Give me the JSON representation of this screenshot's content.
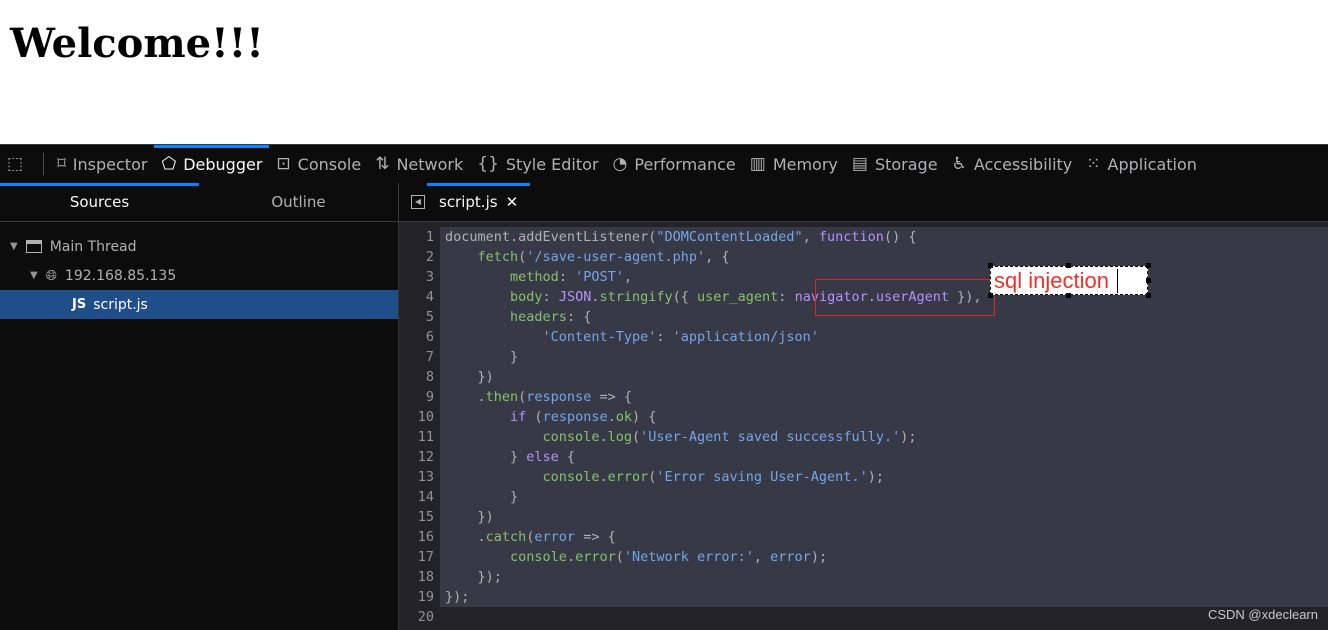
{
  "page": {
    "heading": "Welcome!!!"
  },
  "toolbar": {
    "tools": [
      {
        "label": "Inspector",
        "icon": "inspector-icon",
        "glyph": "⌑"
      },
      {
        "label": "Debugger",
        "icon": "debugger-icon",
        "glyph": "⬠"
      },
      {
        "label": "Console",
        "icon": "console-icon",
        "glyph": "⊡"
      },
      {
        "label": "Network",
        "icon": "network-icon",
        "glyph": "⇅"
      },
      {
        "label": "Style Editor",
        "icon": "style-editor-icon",
        "glyph": "{}"
      },
      {
        "label": "Performance",
        "icon": "performance-icon",
        "glyph": "◔"
      },
      {
        "label": "Memory",
        "icon": "memory-icon",
        "glyph": "▥"
      },
      {
        "label": "Storage",
        "icon": "storage-icon",
        "glyph": "▤"
      },
      {
        "label": "Accessibility",
        "icon": "accessibility-icon",
        "glyph": "♿"
      },
      {
        "label": "Application",
        "icon": "application-icon",
        "glyph": "⁙"
      }
    ],
    "active": "Debugger"
  },
  "sources": {
    "tabs": [
      "Sources",
      "Outline"
    ],
    "thread": "Main Thread",
    "host": "192.168.85.135",
    "file_badge": "JS",
    "file": "script.js"
  },
  "editor": {
    "tab": "script.js",
    "close": "✕",
    "lines": [
      [
        [
          "v",
          "document.addEventListener("
        ],
        [
          "s",
          "\"DOMContentLoaded\""
        ],
        [
          "v",
          ", "
        ],
        [
          "k",
          "function"
        ],
        [
          "v",
          "() {"
        ]
      ],
      [
        [
          "v",
          "    "
        ],
        [
          "p",
          "fetch"
        ],
        [
          "v",
          "("
        ],
        [
          "s",
          "'/save-user-agent.php'"
        ],
        [
          "v",
          ", {"
        ]
      ],
      [
        [
          "v",
          "        "
        ],
        [
          "p",
          "method"
        ],
        [
          "v",
          ": "
        ],
        [
          "s",
          "'POST'"
        ],
        [
          "v",
          ","
        ]
      ],
      [
        [
          "v",
          "        "
        ],
        [
          "p",
          "body"
        ],
        [
          "v",
          ": "
        ],
        [
          "f",
          "JSON"
        ],
        [
          "v",
          "."
        ],
        [
          "p",
          "stringify"
        ],
        [
          "v",
          "({ "
        ],
        [
          "p",
          "user_agent"
        ],
        [
          "v",
          ": "
        ],
        [
          "f",
          "navigator"
        ],
        [
          "v",
          "."
        ],
        [
          "f",
          "userAgent"
        ],
        [
          "v",
          " }),"
        ]
      ],
      [
        [
          "v",
          "        "
        ],
        [
          "p",
          "headers"
        ],
        [
          "v",
          ": {"
        ]
      ],
      [
        [
          "v",
          "            "
        ],
        [
          "s",
          "'Content-Type'"
        ],
        [
          "v",
          ": "
        ],
        [
          "s",
          "'application/json'"
        ]
      ],
      [
        [
          "v",
          "        }"
        ]
      ],
      [
        [
          "v",
          "    })"
        ]
      ],
      [
        [
          "v",
          "    ."
        ],
        [
          "p",
          "then"
        ],
        [
          "v",
          "("
        ],
        [
          "s",
          "response"
        ],
        [
          "v",
          " => {"
        ]
      ],
      [
        [
          "v",
          "        "
        ],
        [
          "k",
          "if"
        ],
        [
          "v",
          " ("
        ],
        [
          "s",
          "response"
        ],
        [
          "v",
          "."
        ],
        [
          "p",
          "ok"
        ],
        [
          "v",
          ") {"
        ]
      ],
      [
        [
          "v",
          "            "
        ],
        [
          "p",
          "console"
        ],
        [
          "v",
          "."
        ],
        [
          "p",
          "log"
        ],
        [
          "v",
          "("
        ],
        [
          "s",
          "'User-Agent saved successfully.'"
        ],
        [
          "v",
          ");"
        ]
      ],
      [
        [
          "v",
          "        } "
        ],
        [
          "k",
          "else"
        ],
        [
          "v",
          " {"
        ]
      ],
      [
        [
          "v",
          "            "
        ],
        [
          "p",
          "console"
        ],
        [
          "v",
          "."
        ],
        [
          "p",
          "error"
        ],
        [
          "v",
          "("
        ],
        [
          "s",
          "'Error saving User-Agent.'"
        ],
        [
          "v",
          ");"
        ]
      ],
      [
        [
          "v",
          "        }"
        ]
      ],
      [
        [
          "v",
          "    })"
        ]
      ],
      [
        [
          "v",
          "    ."
        ],
        [
          "p",
          "catch"
        ],
        [
          "v",
          "("
        ],
        [
          "s",
          "error"
        ],
        [
          "v",
          " => {"
        ]
      ],
      [
        [
          "v",
          "        "
        ],
        [
          "p",
          "console"
        ],
        [
          "v",
          "."
        ],
        [
          "p",
          "error"
        ],
        [
          "v",
          "("
        ],
        [
          "s",
          "'Network error:'"
        ],
        [
          "v",
          ", "
        ],
        [
          "s",
          "error"
        ],
        [
          "v",
          ");"
        ]
      ],
      [
        [
          "v",
          "    });"
        ]
      ],
      [
        [
          "v",
          "});"
        ]
      ],
      [
        [
          "v",
          ""
        ]
      ]
    ]
  },
  "annotation": {
    "text": "sql injection",
    "color": "#f0302b"
  },
  "watermark": "CSDN @xdeclearn",
  "colors": {
    "accent": "#0a84ff",
    "selected_row": "#204e8a"
  }
}
